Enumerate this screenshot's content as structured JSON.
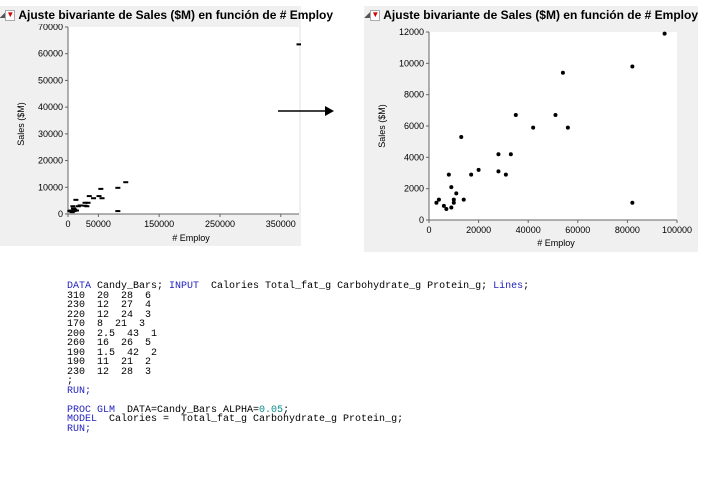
{
  "charts": [
    {
      "title": "Ajuste bivariante de Sales ($M) en función de # Employ",
      "xlabel": "# Employ",
      "ylabel": "Sales ($M)",
      "xticks": [
        "0",
        "50000",
        "150000",
        "250000",
        "350000"
      ],
      "yticks": [
        "0",
        "10000",
        "20000",
        "30000",
        "40000",
        "50000",
        "60000",
        "70000"
      ]
    },
    {
      "title": "Ajuste bivariante de Sales ($M) en función de # Employ",
      "xlabel": "# Employ",
      "ylabel": "Sales ($M)",
      "xticks": [
        "0",
        "20000",
        "40000",
        "60000",
        "80000",
        "100000"
      ],
      "yticks": [
        "0",
        "2000",
        "4000",
        "6000",
        "8000",
        "10000",
        "12000"
      ]
    }
  ],
  "chart_data": [
    {
      "type": "scatter",
      "xlim": [
        0,
        380000
      ],
      "ylim": [
        0,
        70000
      ],
      "points": [
        [
          380000,
          63500
        ],
        [
          95000,
          11900
        ],
        [
          82000,
          9800
        ],
        [
          54000,
          9400
        ],
        [
          35000,
          6700
        ],
        [
          51000,
          6700
        ],
        [
          56000,
          5900
        ],
        [
          42000,
          5900
        ],
        [
          28000,
          4200
        ],
        [
          33000,
          4200
        ],
        [
          28000,
          3100
        ],
        [
          31000,
          2900
        ],
        [
          13000,
          5300
        ],
        [
          20000,
          3200
        ],
        [
          17000,
          2900
        ],
        [
          8000,
          2900
        ],
        [
          9000,
          2100
        ],
        [
          11000,
          1700
        ],
        [
          82000,
          1100
        ],
        [
          14000,
          1300
        ],
        [
          4000,
          1300
        ],
        [
          6000,
          900
        ],
        [
          7000,
          700
        ],
        [
          3000,
          1100
        ],
        [
          10000,
          1100
        ]
      ]
    },
    {
      "type": "scatter",
      "xlim": [
        0,
        100000
      ],
      "ylim": [
        0,
        12000
      ],
      "points": [
        [
          95000,
          11900
        ],
        [
          82000,
          9800
        ],
        [
          54000,
          9400
        ],
        [
          35000,
          6700
        ],
        [
          51000,
          6700
        ],
        [
          56000,
          5900
        ],
        [
          42000,
          5900
        ],
        [
          28000,
          4200
        ],
        [
          33000,
          4200
        ],
        [
          28000,
          3100
        ],
        [
          31000,
          2900
        ],
        [
          13000,
          5300
        ],
        [
          20000,
          3200
        ],
        [
          17000,
          2900
        ],
        [
          8000,
          2900
        ],
        [
          9000,
          2100
        ],
        [
          11000,
          1700
        ],
        [
          82000,
          1100
        ],
        [
          14000,
          1300
        ],
        [
          4000,
          1300
        ],
        [
          6000,
          900
        ],
        [
          7000,
          700
        ],
        [
          3000,
          1100
        ],
        [
          10000,
          1100
        ],
        [
          9000,
          800
        ],
        [
          10000,
          1300
        ]
      ]
    }
  ],
  "code": {
    "data_kw": "DATA",
    "data_name": " Candy_Bars; ",
    "input_kw": "INPUT",
    "input_vars": "  Calories Total_fat_g Carbohydrate_g Protein_g; ",
    "lines_kw": "Lines",
    "lines_end": ";",
    "rows": [
      "310  20  28  6",
      "230  12  27  4",
      "220  12  24  3",
      "170  8  21  3",
      "200  2.5  43  1",
      "260  16  26  5",
      "190  1.5  42  2",
      "190  11  21  2",
      "230  12  28  3",
      ";"
    ],
    "run1": "RUN;",
    "proc_kw": "PROC GLM",
    "proc_data": "  DATA=Candy_Bars ALPHA=",
    "alpha": "0.05",
    "proc_end": ";",
    "model_kw": "MODEL",
    "model_text": "  Calories =  Total_fat_g Carbohydrate_g Protein_g;",
    "run2": "RUN;"
  }
}
